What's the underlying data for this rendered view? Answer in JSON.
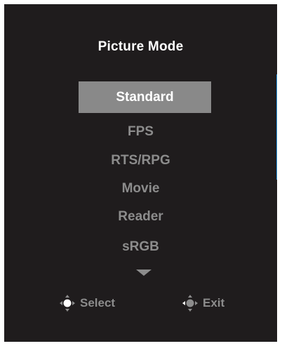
{
  "osd": {
    "title": "Picture Mode",
    "items": [
      {
        "label": "Standard",
        "selected": true
      },
      {
        "label": "FPS",
        "selected": false
      },
      {
        "label": "RTS/RPG",
        "selected": false
      },
      {
        "label": "Movie",
        "selected": false
      },
      {
        "label": "Reader",
        "selected": false
      },
      {
        "label": "sRGB",
        "selected": false
      }
    ],
    "more_icon": "triangle-down-icon",
    "hints": {
      "select_label": "Select",
      "select_icon": "joystick-press-icon",
      "exit_label": "Exit",
      "exit_icon": "joystick-left-icon"
    }
  },
  "colors": {
    "panel_bg": "#1f1c1d",
    "selected_bg": "#898989",
    "item_text": "#8c8c8c",
    "scrollbar": "#1e88d8"
  }
}
